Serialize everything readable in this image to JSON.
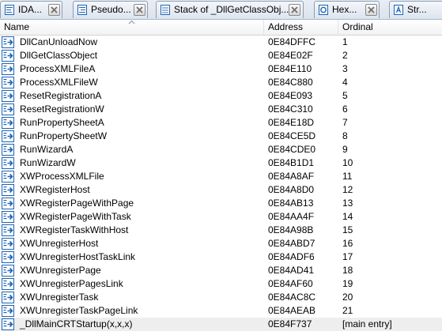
{
  "tabs": [
    {
      "label": "IDA...",
      "icon": "ida-view-icon"
    },
    {
      "label": "Pseudo...",
      "icon": "pseudocode-icon"
    },
    {
      "label": "Stack of _DllGetClassObj...",
      "icon": "stack-icon"
    },
    {
      "label": "Hex...",
      "icon": "hex-icon"
    },
    {
      "label": "Str...",
      "icon": "strings-icon"
    }
  ],
  "table": {
    "columns": {
      "name": "Name",
      "address": "Address",
      "ordinal": "Ordinal"
    },
    "sort_column": "name",
    "rows": [
      {
        "name": "DllCanUnloadNow",
        "address": "0E84DFFC",
        "ordinal": "1"
      },
      {
        "name": "DllGetClassObject",
        "address": "0E84E02F",
        "ordinal": "2"
      },
      {
        "name": "ProcessXMLFileA",
        "address": "0E84E110",
        "ordinal": "3"
      },
      {
        "name": "ProcessXMLFileW",
        "address": "0E84C880",
        "ordinal": "4"
      },
      {
        "name": "ResetRegistrationA",
        "address": "0E84E093",
        "ordinal": "5"
      },
      {
        "name": "ResetRegistrationW",
        "address": "0E84C310",
        "ordinal": "6"
      },
      {
        "name": "RunPropertySheetA",
        "address": "0E84E18D",
        "ordinal": "7"
      },
      {
        "name": "RunPropertySheetW",
        "address": "0E84CE5D",
        "ordinal": "8"
      },
      {
        "name": "RunWizardA",
        "address": "0E84CDE0",
        "ordinal": "9"
      },
      {
        "name": "RunWizardW",
        "address": "0E84B1D1",
        "ordinal": "10"
      },
      {
        "name": "XWProcessXMLFile",
        "address": "0E84A8AF",
        "ordinal": "11"
      },
      {
        "name": "XWRegisterHost",
        "address": "0E84A8D0",
        "ordinal": "12"
      },
      {
        "name": "XWRegisterPageWithPage",
        "address": "0E84AB13",
        "ordinal": "13"
      },
      {
        "name": "XWRegisterPageWithTask",
        "address": "0E84AA4F",
        "ordinal": "14"
      },
      {
        "name": "XWRegisterTaskWithHost",
        "address": "0E84A98B",
        "ordinal": "15"
      },
      {
        "name": "XWUnregisterHost",
        "address": "0E84ABD7",
        "ordinal": "16"
      },
      {
        "name": "XWUnregisterHostTaskLink",
        "address": "0E84ADF6",
        "ordinal": "17"
      },
      {
        "name": "XWUnregisterPage",
        "address": "0E84AD41",
        "ordinal": "18"
      },
      {
        "name": "XWUnregisterPagesLink",
        "address": "0E84AF60",
        "ordinal": "19"
      },
      {
        "name": "XWUnregisterTask",
        "address": "0E84AC8C",
        "ordinal": "20"
      },
      {
        "name": "XWUnregisterTaskPageLink",
        "address": "0E84AEAB",
        "ordinal": "21"
      },
      {
        "name": "_DllMainCRTStartup(x,x,x)",
        "address": "0E84F737",
        "ordinal": "[main entry]",
        "selected": true
      }
    ]
  },
  "colors": {
    "icon_blue": "#1d64b5",
    "selected_row": "#eeeeee",
    "tab_close_x": "#8a8a8a"
  }
}
